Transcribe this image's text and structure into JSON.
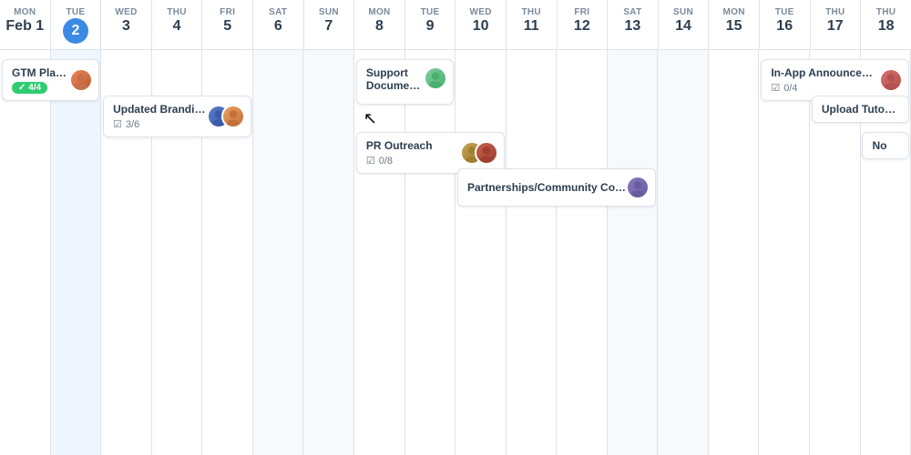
{
  "calendar": {
    "headers": [
      {
        "day": "MON",
        "date": "Feb 1",
        "today": false,
        "weekend": false
      },
      {
        "day": "TUE",
        "date": "2",
        "today": true,
        "weekend": false
      },
      {
        "day": "WED",
        "date": "3",
        "today": false,
        "weekend": false
      },
      {
        "day": "THU",
        "date": "4",
        "today": false,
        "weekend": false
      },
      {
        "day": "FRI",
        "date": "5",
        "today": false,
        "weekend": false
      },
      {
        "day": "SAT",
        "date": "6",
        "today": false,
        "weekend": true
      },
      {
        "day": "SUN",
        "date": "7",
        "today": false,
        "weekend": true
      },
      {
        "day": "MON",
        "date": "8",
        "today": false,
        "weekend": false
      },
      {
        "day": "TUE",
        "date": "9",
        "today": false,
        "weekend": false
      },
      {
        "day": "WED",
        "date": "10",
        "today": false,
        "weekend": false
      },
      {
        "day": "THU",
        "date": "11",
        "today": false,
        "weekend": false
      },
      {
        "day": "FRI",
        "date": "12",
        "today": false,
        "weekend": false
      },
      {
        "day": "SAT",
        "date": "13",
        "today": false,
        "weekend": true
      },
      {
        "day": "SUN",
        "date": "14",
        "today": false,
        "weekend": true
      },
      {
        "day": "MON",
        "date": "15",
        "today": false,
        "weekend": false
      },
      {
        "day": "TUE",
        "date": "16",
        "today": false,
        "weekend": false
      },
      {
        "day": "THU",
        "date": "17",
        "today": false,
        "weekend": false
      },
      {
        "day": "THU",
        "date": "18",
        "today": false,
        "weekend": false
      }
    ],
    "events": {
      "gtm": {
        "title": "GTM Plan and Messa...",
        "badge": "4/4",
        "col_start": 0,
        "col_span": 2,
        "row": 1,
        "avatar_colors": [
          "#e8855a"
        ]
      },
      "updated_branding": {
        "title": "Updated Branding & Logos",
        "progress": "3/6",
        "col_start": 2,
        "col_span": 3,
        "row": 2,
        "avatar_colors": [
          "#5a85c4",
          "#e8a060"
        ]
      },
      "support_docs": {
        "title": "Support Documentation",
        "col_start": 7,
        "col_span": 2,
        "row": 1,
        "avatar_colors": [
          "#7ecfa0"
        ]
      },
      "pr_outreach": {
        "title": "PR Outreach",
        "progress": "0/8",
        "col_start": 7,
        "col_span": 3,
        "row": 3,
        "avatar_colors": [
          "#c4a050",
          "#c46050"
        ]
      },
      "partnerships": {
        "title": "Partnerships/Community Content",
        "col_start": 9,
        "col_span": 4,
        "row": 4,
        "avatar_colors": [
          "#8a7abf"
        ]
      },
      "inapp": {
        "title": "In-App Announcement",
        "progress": "0/4",
        "col_start": 15,
        "col_span": 3,
        "row": 1,
        "avatar_colors": [
          "#d4706a"
        ]
      },
      "tutorial": {
        "title": "Upload Tutorial Videos",
        "col_start": 16,
        "col_span": 2,
        "row": 2,
        "avatar_colors": []
      },
      "no_label": {
        "title": "No",
        "col_start": 17,
        "col_span": 1,
        "row": 3,
        "avatar_colors": []
      }
    }
  }
}
